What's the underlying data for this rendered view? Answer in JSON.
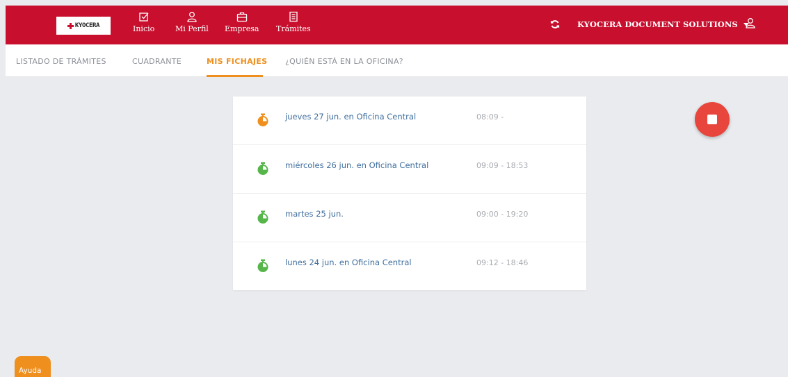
{
  "brand": {
    "logo_text": "KYOCERA"
  },
  "nav": [
    {
      "label": "Inicio",
      "icon": "checkbox-icon"
    },
    {
      "label": "Mi Perfil",
      "icon": "user-icon"
    },
    {
      "label": "Empresa",
      "icon": "briefcase-icon"
    },
    {
      "label": "Trámites",
      "icon": "document-icon"
    }
  ],
  "header": {
    "company": "KYOCERA DOCUMENT SOLUTIONS"
  },
  "tabs": [
    {
      "label": "LISTADO DE TRÁMITES",
      "active": false
    },
    {
      "label": "CUADRANTE",
      "active": false
    },
    {
      "label": "MIS FICHAJES",
      "active": true
    },
    {
      "label": "¿QUIÉN ESTÁ EN LA OFICINA?",
      "active": false
    }
  ],
  "entries": [
    {
      "label": "jueves 27 jun. en Oficina Central",
      "time": "08:09 -",
      "status": "in-progress",
      "icon": "stopwatch-icon"
    },
    {
      "label": "miércoles 26 jun. en Oficina Central",
      "time": "09:09 - 18:53",
      "status": "complete",
      "icon": "stopwatch-icon"
    },
    {
      "label": "martes 25 jun.",
      "time": "09:00 - 19:20",
      "status": "complete",
      "icon": "stopwatch-icon"
    },
    {
      "label": "lunes 24 jun. en Oficina Central",
      "time": "09:12 - 18:46",
      "status": "complete",
      "icon": "stopwatch-icon"
    }
  ],
  "help": {
    "label": "Ayuda"
  },
  "colors": {
    "brand_red": "#c8102e",
    "accent_orange": "#ee8f1e",
    "ok_green": "#56b64a",
    "stop_red": "#e8453c"
  }
}
